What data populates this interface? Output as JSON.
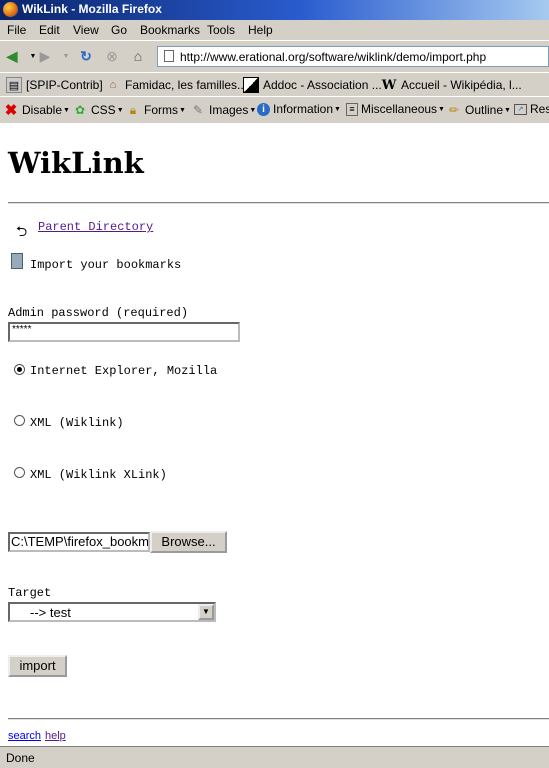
{
  "window": {
    "title": "WikLink - Mozilla Firefox"
  },
  "menu": [
    "File",
    "Edit",
    "View",
    "Go",
    "Bookmarks",
    "Tools",
    "Help"
  ],
  "url": "http://www.erational.org/software/wiklink/demo/import.php",
  "bookmarks": [
    "[SPIP-Contrib]",
    "Famidac, les familles...",
    "Addoc - Association ...",
    "Accueil - Wikipédia, l..."
  ],
  "webdev": [
    "Disable",
    "CSS",
    "Forms",
    "Images",
    "Information",
    "Miscellaneous",
    "Outline",
    "Res"
  ],
  "page": {
    "title": "WikLink",
    "parent_link": "Parent Directory",
    "import_heading": "Import your bookmarks",
    "password_label": "Admin password (required)",
    "password_value": "*****",
    "formats": [
      "Internet Explorer, Mozilla",
      "XML (Wiklink)",
      "XML (Wiklink XLink)"
    ],
    "selected_format": "Internet Explorer, Mozilla",
    "file_value": "C:\\TEMP\\firefox_bookm",
    "browse_label": "Browse...",
    "target_label": "Target",
    "target_value": "--> test",
    "import_label": "import",
    "footer_links": [
      "search",
      "help"
    ]
  },
  "status": "Done"
}
